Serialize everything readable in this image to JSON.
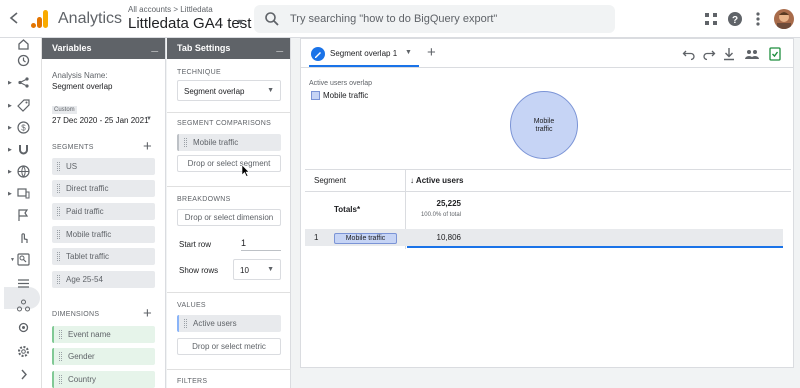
{
  "header": {
    "back_icon": "arrow-back-icon",
    "app_name": "Analytics",
    "breadcrumb": "All accounts > Littledata",
    "property": "Littledata GA4 test",
    "search_placeholder": "Try searching \"how to do BigQuery export\"",
    "icons": [
      "apps-icon",
      "help-icon",
      "more-vert-icon"
    ]
  },
  "nav_icons": [
    "home-icon",
    "clock-icon",
    "explore-icon",
    "tag-icon",
    "dollar-icon",
    "magnet-icon",
    "globe-icon",
    "devices-icon",
    "flag-icon",
    "touch-icon",
    "explorations-icon",
    "list-icon",
    "hierarchy-icon",
    "settings-bug-icon",
    "settings-icon",
    "expand-icon"
  ],
  "variables": {
    "title": "Variables",
    "minimize": "_",
    "analysis_name_label": "Analysis Name:",
    "analysis_name": "Segment overlap",
    "date_badge": "Custom",
    "date_range": "27 Dec 2020 - 25 Jan 2021",
    "segments_label": "SEGMENTS",
    "segments": [
      "US",
      "Direct traffic",
      "Paid traffic",
      "Mobile traffic",
      "Tablet traffic",
      "Age 25-54"
    ],
    "dimensions_label": "DIMENSIONS",
    "dimensions": [
      "Event name",
      "Gender",
      "Country"
    ]
  },
  "tab_settings": {
    "title": "Tab Settings",
    "minimize": "_",
    "technique_label": "TECHNIQUE",
    "technique": "Segment overlap",
    "segment_comparisons_label": "SEGMENT COMPARISONS",
    "segment_comparison": "Mobile traffic",
    "drop_segment": "Drop or select segment",
    "breakdowns_label": "BREAKDOWNS",
    "drop_dimension": "Drop or select dimension",
    "start_row_label": "Start row",
    "start_row": "1",
    "show_rows_label": "Show rows",
    "show_rows": "10",
    "values_label": "VALUES",
    "value": "Active users",
    "drop_metric": "Drop or select metric",
    "filters_label": "FILTERS"
  },
  "canvas": {
    "tab_label": "Segment overlap 1",
    "viz_title": "Active users overlap",
    "legend": "Mobile traffic",
    "circle_label_1": "Mobile",
    "circle_label_2": "traffic",
    "col_segment": "Segment",
    "col_metric": "↓ Active users",
    "totals_label": "Totals*",
    "totals_value": "25,225",
    "totals_pct": "100.0% of total",
    "row_index": "1",
    "row_segment": "Mobile traffic",
    "row_value": "10,806"
  },
  "colors": {
    "accent": "#1a73e8",
    "segment_fill": "#c6d4f5",
    "panel_header": "#5f6368",
    "save_green": "#1e8e3e"
  }
}
